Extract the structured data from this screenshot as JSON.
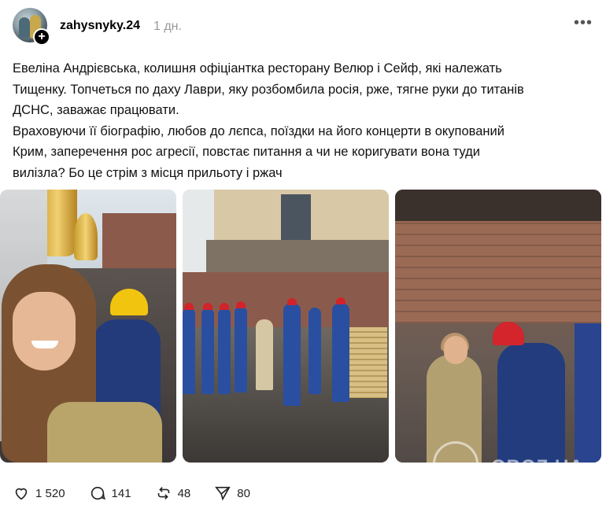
{
  "post": {
    "username": "zahysnyky.24",
    "time": "1 дн.",
    "more_icon": "ellipsis-icon",
    "text_lines": [
      "Евеліна Андрієвська, колишня офіціантка ресторану Велюр і Сейф, які належать",
      "Тищенку. Топчеться по даху Лаври, яку розбомбила росія, рже, тягне руки до титанів",
      "ДСНС, заважає працювати.",
      "Враховуючи її біографію, любов до лєпса, поїздки на його концерти в окупований",
      "Крим, заперечення рос агресії, повстає питання а чи не коригувати вона туди",
      "вилізла? Бо це стрім з місця прильоту і ржач"
    ],
    "watermark": "OBOZ.UA"
  },
  "actions": {
    "likes": "1 520",
    "comments": "141",
    "reposts": "48",
    "shares": "80"
  },
  "colors": {
    "username": "#000000",
    "muted": "#999999",
    "rescuer_uniform": "#233b7a",
    "helmet_red": "#d4242c",
    "helmet_yellow": "#f1c40f"
  }
}
